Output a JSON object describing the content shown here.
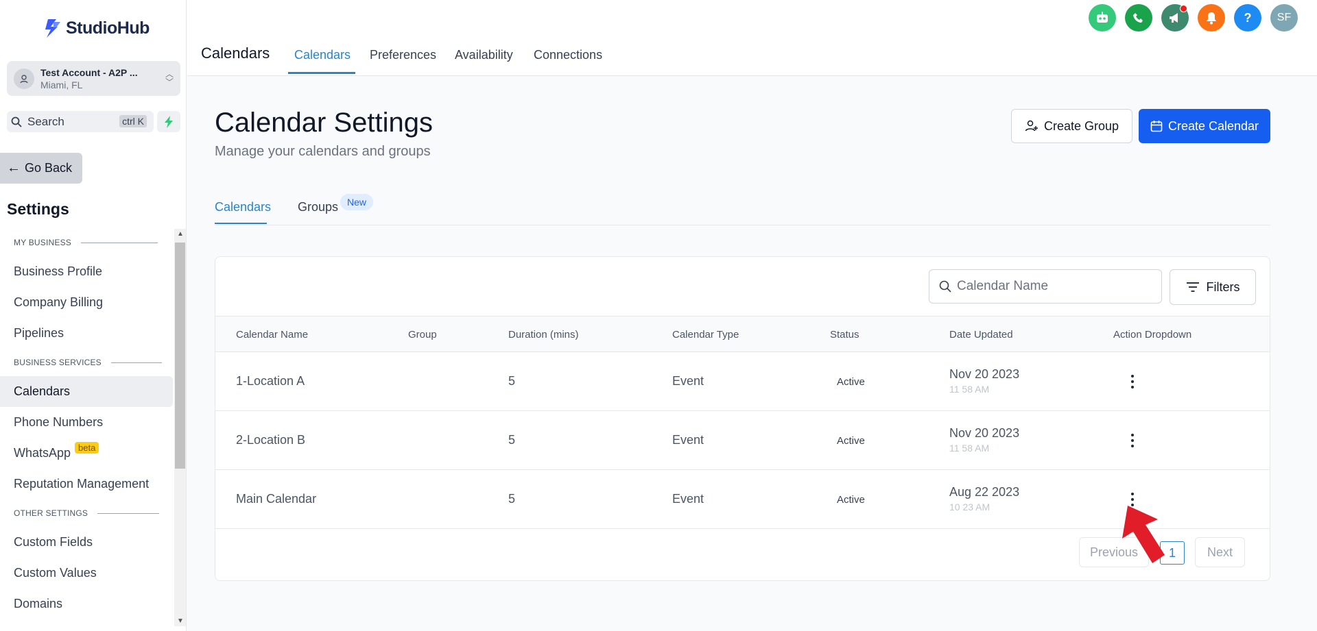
{
  "brand": {
    "name": "StudioHub"
  },
  "account": {
    "name": "Test Account - A2P ...",
    "location": "Miami, FL"
  },
  "search": {
    "label": "Search",
    "shortcut": "ctrl K"
  },
  "sidebar": {
    "go_back": "Go Back",
    "title": "Settings",
    "sections": [
      {
        "label": "MY BUSINESS",
        "items": [
          "Business Profile",
          "Company Billing",
          "Pipelines"
        ]
      },
      {
        "label": "BUSINESS SERVICES",
        "items": [
          "Calendars",
          "Phone Numbers",
          "WhatsApp",
          "Reputation Management"
        ]
      },
      {
        "label": "OTHER SETTINGS",
        "items": [
          "Custom Fields",
          "Custom Values",
          "Domains"
        ]
      }
    ],
    "active_item": "Calendars",
    "beta_badge": "beta"
  },
  "header": {
    "title": "Calendars",
    "tabs": [
      "Calendars",
      "Preferences",
      "Availability",
      "Connections"
    ],
    "active_tab": "Calendars",
    "avatar_initials": "SF",
    "icons": [
      {
        "name": "robot-icon",
        "color": "#34c97b"
      },
      {
        "name": "phone-icon",
        "color": "#1aa34a"
      },
      {
        "name": "megaphone-icon",
        "color": "#3d8a6e"
      },
      {
        "name": "bell-icon",
        "color": "#f97316"
      },
      {
        "name": "help-icon",
        "color": "#1d8bf1"
      },
      {
        "name": "avatar",
        "color": "#7fa6b3"
      }
    ]
  },
  "main": {
    "title": "Calendar Settings",
    "subtitle": "Manage your calendars and groups",
    "create_group": "Create Group",
    "create_calendar": "Create Calendar",
    "tabs": [
      "Calendars",
      "Groups"
    ],
    "new_badge": "New",
    "search_placeholder": "Calendar Name",
    "filters": "Filters",
    "columns": [
      "Calendar Name",
      "Group",
      "Duration (mins)",
      "Calendar Type",
      "Status",
      "Date Updated",
      "Action Dropdown"
    ],
    "rows": [
      {
        "name": "1-Location A",
        "group": "",
        "duration": "5",
        "type": "Event",
        "status": "Active",
        "date": "Nov 20 2023",
        "time": "11 58 AM"
      },
      {
        "name": "2-Location B",
        "group": "",
        "duration": "5",
        "type": "Event",
        "status": "Active",
        "date": "Nov 20 2023",
        "time": "11 58 AM"
      },
      {
        "name": "Main Calendar",
        "group": "",
        "duration": "5",
        "type": "Event",
        "status": "Active",
        "date": "Aug 22 2023",
        "time": "10 23 AM"
      }
    ],
    "pagination": {
      "previous": "Previous",
      "page": "1",
      "next": "Next"
    }
  },
  "colors": {
    "primary": "#155eef",
    "accent": "#2b84c6",
    "pointer_arrow": "#e11d2a"
  }
}
